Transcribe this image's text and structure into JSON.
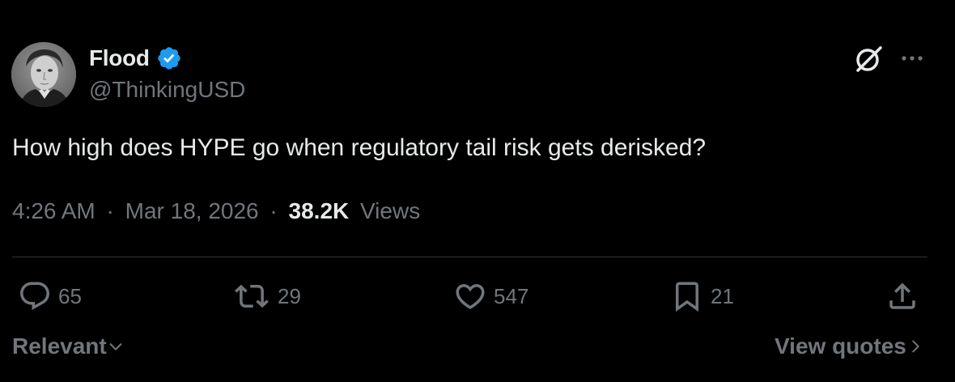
{
  "author": {
    "display_name": "Flood",
    "handle": "@ThinkingUSD",
    "verified": true,
    "verified_color": "#1d9bf0"
  },
  "tweet": {
    "text": "How high does HYPE go when regulatory tail risk gets derisked?",
    "time": "4:26 AM",
    "date": "Mar 18, 2026",
    "separator": "·",
    "views_count": "38.2K",
    "views_label": "Views"
  },
  "actions": {
    "replies": "65",
    "retweets": "29",
    "likes": "547",
    "bookmarks": "21"
  },
  "footer": {
    "sort_label": "Relevant",
    "view_quotes_label": "View quotes"
  },
  "icons": {
    "avatar": "avatar",
    "verified": "verified-badge-icon",
    "grok": "grok-icon",
    "more": "more-icon",
    "reply": "reply-icon",
    "retweet": "retweet-icon",
    "like": "heart-icon",
    "bookmark": "bookmark-icon",
    "share": "share-icon",
    "chevron_down": "chevron-down-icon",
    "chevron_right": "chevron-right-icon"
  },
  "colors": {
    "background": "#000000",
    "primary_text": "#e7e9ea",
    "secondary_text": "#71767b",
    "divider": "#2f3336",
    "accent": "#1d9bf0"
  }
}
